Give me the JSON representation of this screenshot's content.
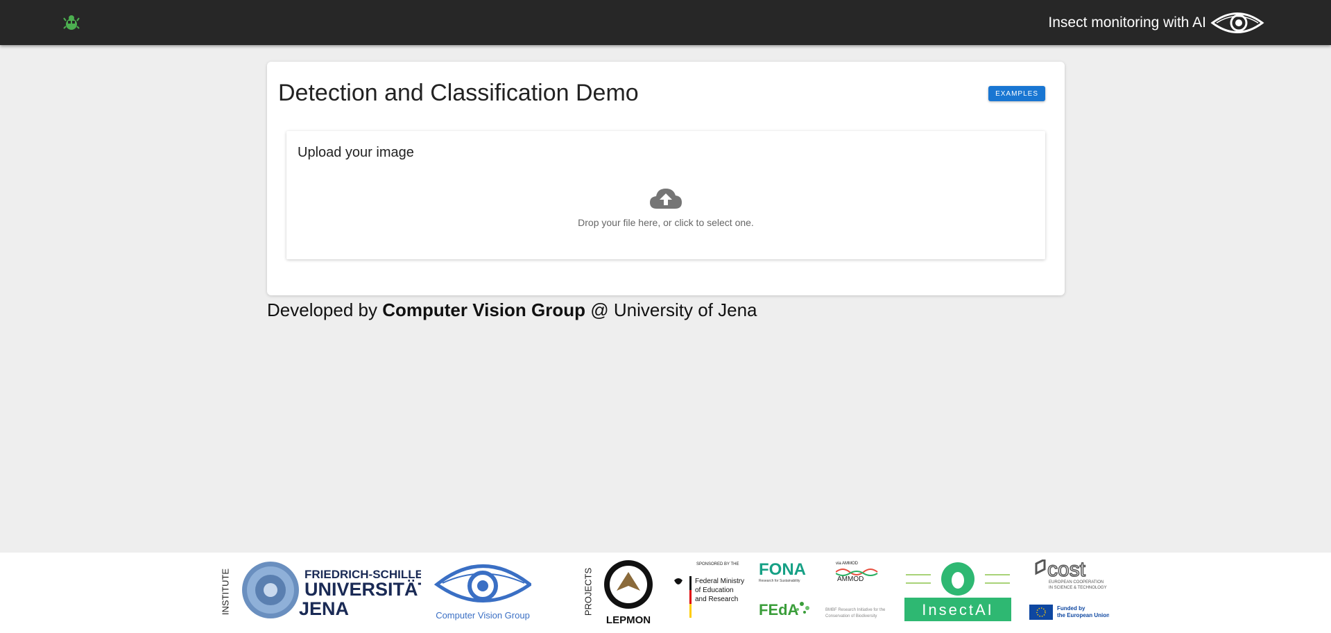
{
  "header": {
    "logo_icon": "bug-icon",
    "title": "Insect monitoring with AI",
    "eye_logo_icon": "eye-icon"
  },
  "card": {
    "title": "Detection and Classification Demo",
    "examples_label": "EXAMPLES",
    "upload": {
      "title": "Upload your image",
      "icon": "cloud-upload-icon",
      "drop_text": "Drop your file here, or click to select one."
    }
  },
  "credit": {
    "prefix": "Developed by ",
    "group": "Computer Vision Group",
    "suffix": " @ University of Jena"
  },
  "sponsors": {
    "institute_label": "INSTITUTE",
    "projects_label": "PROJECTS",
    "uni": {
      "line1": "FRIEDRICH-SCHILLER-",
      "line2": "UNIVERSITÄT",
      "line3": "JENA"
    },
    "cvg": {
      "name": "Computer Vision Group"
    },
    "lepmon": {
      "name": "LEPMON"
    },
    "bmbf": {
      "sponsored": "SPONSORED BY THE",
      "line1": "Federal Ministry",
      "line2": "of Education",
      "line3": "and Research"
    },
    "fona": {
      "name": "FONA",
      "tag": "Research for Sustainability"
    },
    "ammod": {
      "top": "via AMMOD",
      "name": "AMMOD"
    },
    "feda": {
      "name": "FEdA",
      "tag1": "BMBF Research Initiative for the",
      "tag2": "Conservation of Biodiversity"
    },
    "insectai": {
      "name": "InsectAI"
    },
    "cost": {
      "name": "cost",
      "line1": "EUROPEAN COOPERATION",
      "line2": "IN SCIENCE & TECHNOLOGY"
    },
    "eu": {
      "line1": "Funded by",
      "line2": "the European Union"
    }
  },
  "colors": {
    "topbar": "#272727",
    "accent": "#1976d2",
    "green": "#4caf50",
    "blue_dark": "#1a2a55"
  }
}
